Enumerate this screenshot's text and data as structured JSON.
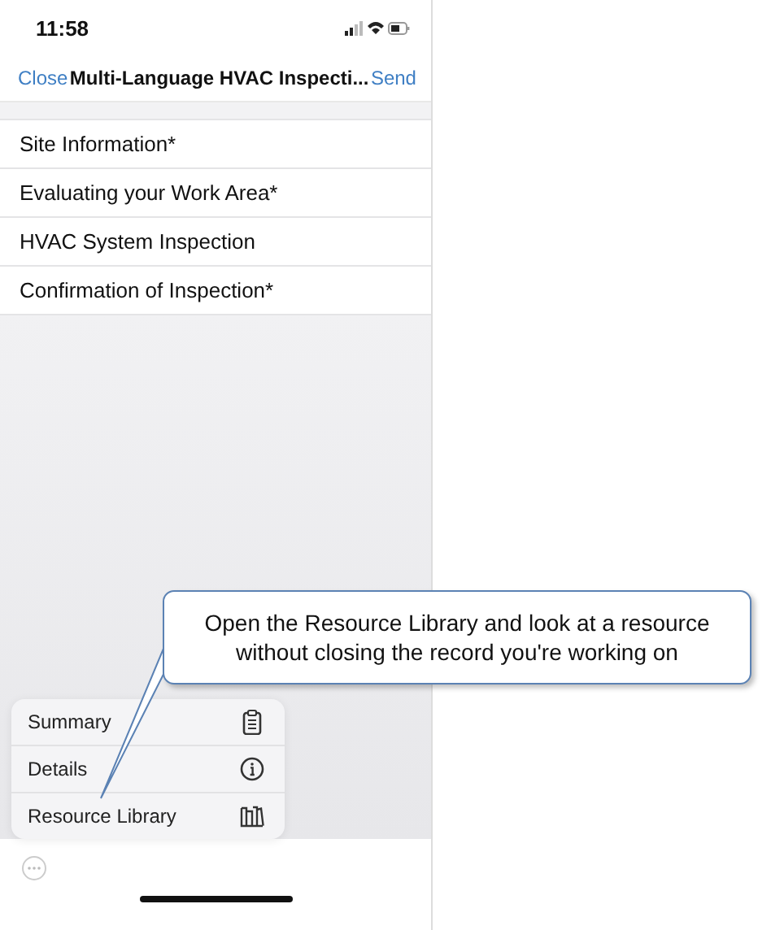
{
  "status_bar": {
    "time": "11:58"
  },
  "nav_bar": {
    "left_button": "Close",
    "title": "Multi-Language HVAC Inspecti...",
    "right_button": "Send"
  },
  "sections": [
    {
      "label": "Site Information*"
    },
    {
      "label": "Evaluating your Work Area*"
    },
    {
      "label": "HVAC System Inspection"
    },
    {
      "label": "Confirmation of Inspection*"
    }
  ],
  "menu": [
    {
      "label": "Summary",
      "kind": "clipboard"
    },
    {
      "label": "Details",
      "kind": "info"
    },
    {
      "label": "Resource Library",
      "kind": "books"
    }
  ],
  "callout": {
    "text": "Open the Resource Library and look at a resource without closing the record you're working on"
  }
}
